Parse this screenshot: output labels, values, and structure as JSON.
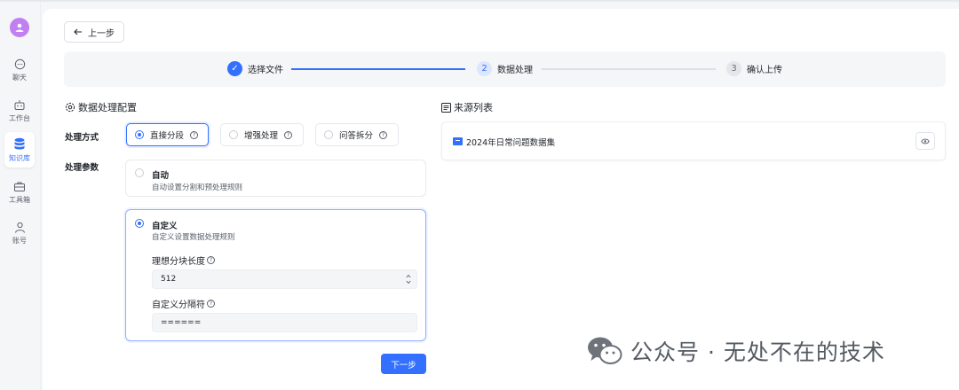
{
  "sidebar": {
    "items": [
      {
        "label": "聊天",
        "icon": "chat-icon"
      },
      {
        "label": "工作台",
        "icon": "robot-icon"
      },
      {
        "label": "知识库",
        "icon": "database-icon",
        "active": true
      },
      {
        "label": "工具箱",
        "icon": "toolbox-icon"
      },
      {
        "label": "账号",
        "icon": "user-icon"
      }
    ]
  },
  "header": {
    "back_label": "上一步"
  },
  "steps": [
    {
      "num": "✓",
      "label": "选择文件",
      "state": "done"
    },
    {
      "num": "2",
      "label": "数据处理",
      "state": "current"
    },
    {
      "num": "3",
      "label": "确认上传",
      "state": "todo"
    }
  ],
  "config": {
    "title": "数据处理配置",
    "method_label": "处理方式",
    "methods": [
      {
        "label": "直接分段",
        "selected": true
      },
      {
        "label": "增强处理",
        "selected": false
      },
      {
        "label": "问答拆分",
        "selected": false
      }
    ],
    "params_label": "处理参数",
    "auto": {
      "title": "自动",
      "desc": "自动设置分割和预处理规则"
    },
    "custom": {
      "title": "自定义",
      "desc": "自定义设置数据处理规则",
      "chunk_label": "理想分块长度",
      "chunk_value": "512",
      "separator_label": "自定义分隔符",
      "separator_value": "======"
    },
    "next_label": "下一步"
  },
  "source": {
    "title": "来源列表",
    "items": [
      {
        "name": "2024年日常问题数据集"
      }
    ]
  },
  "watermark": {
    "text": "公众号 · 无处不在的技术"
  },
  "colors": {
    "accent": "#3370ff",
    "avatar": "#c27ff0"
  }
}
